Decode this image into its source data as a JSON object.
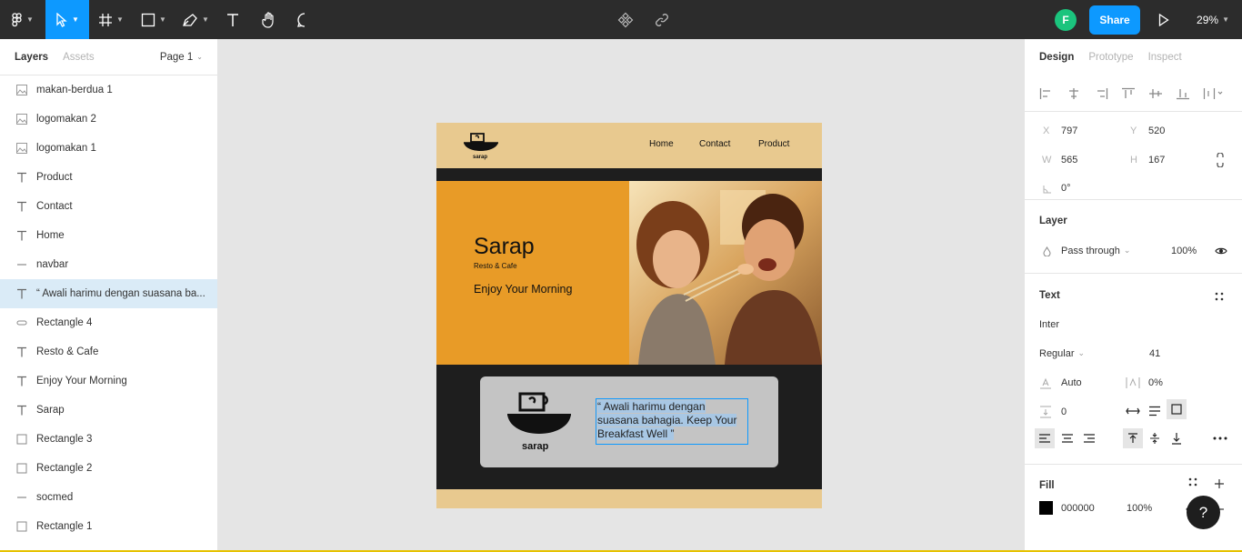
{
  "toolbar": {
    "share_label": "Share",
    "avatar_initial": "F",
    "zoom_label": "29%"
  },
  "left_panel": {
    "tabs": [
      "Layers",
      "Assets"
    ],
    "page_label": "Page 1",
    "layers": [
      {
        "name": "makan-berdua 1",
        "type": "image"
      },
      {
        "name": "logomakan 2",
        "type": "image"
      },
      {
        "name": "logomakan 1",
        "type": "image"
      },
      {
        "name": "Product",
        "type": "text"
      },
      {
        "name": "Contact",
        "type": "text"
      },
      {
        "name": "Home",
        "type": "text"
      },
      {
        "name": "navbar",
        "type": "line"
      },
      {
        "name": "“ Awali harimu dengan suasana ba...",
        "type": "text",
        "selected": true
      },
      {
        "name": "Rectangle 4",
        "type": "rect-thin"
      },
      {
        "name": "Resto & Cafe",
        "type": "text"
      },
      {
        "name": "Enjoy Your Morning",
        "type": "text"
      },
      {
        "name": "Sarap",
        "type": "text"
      },
      {
        "name": "Rectangle 3",
        "type": "rect"
      },
      {
        "name": "Rectangle 2",
        "type": "rect"
      },
      {
        "name": "socmed",
        "type": "line"
      },
      {
        "name": "Rectangle 1",
        "type": "rect"
      }
    ]
  },
  "design": {
    "nav_links": [
      "Home",
      "Contact",
      "Product"
    ],
    "logo_text": "sarap",
    "hero_title": "Sarap",
    "hero_subtitle": "Resto & Cafe",
    "hero_tagline": "Enjoy Your Morning",
    "quote": "“ Awali harimu dengan suasana bahagia. Keep Your Breakfast Well ”",
    "colors": {
      "nav": "#e8c98f",
      "hero": "#e89b27",
      "dark": "#1e1e1e",
      "card": "#c4c4c4"
    }
  },
  "right_panel": {
    "tabs": [
      "Design",
      "Prototype",
      "Inspect"
    ],
    "x_label": "X",
    "x_value": "797",
    "y_label": "Y",
    "y_value": "520",
    "w_label": "W",
    "w_value": "565",
    "h_label": "H",
    "h_value": "167",
    "rotation": "0°",
    "layer_title": "Layer",
    "blend_mode": "Pass through",
    "opacity": "100%",
    "text_title": "Text",
    "font_family": "Inter",
    "font_style": "Regular",
    "font_size": "41",
    "line_height": "Auto",
    "letter_spacing": "0%",
    "paragraph_spacing": "0",
    "fill_title": "Fill",
    "fill_hex": "000000",
    "fill_opacity": "100%"
  }
}
